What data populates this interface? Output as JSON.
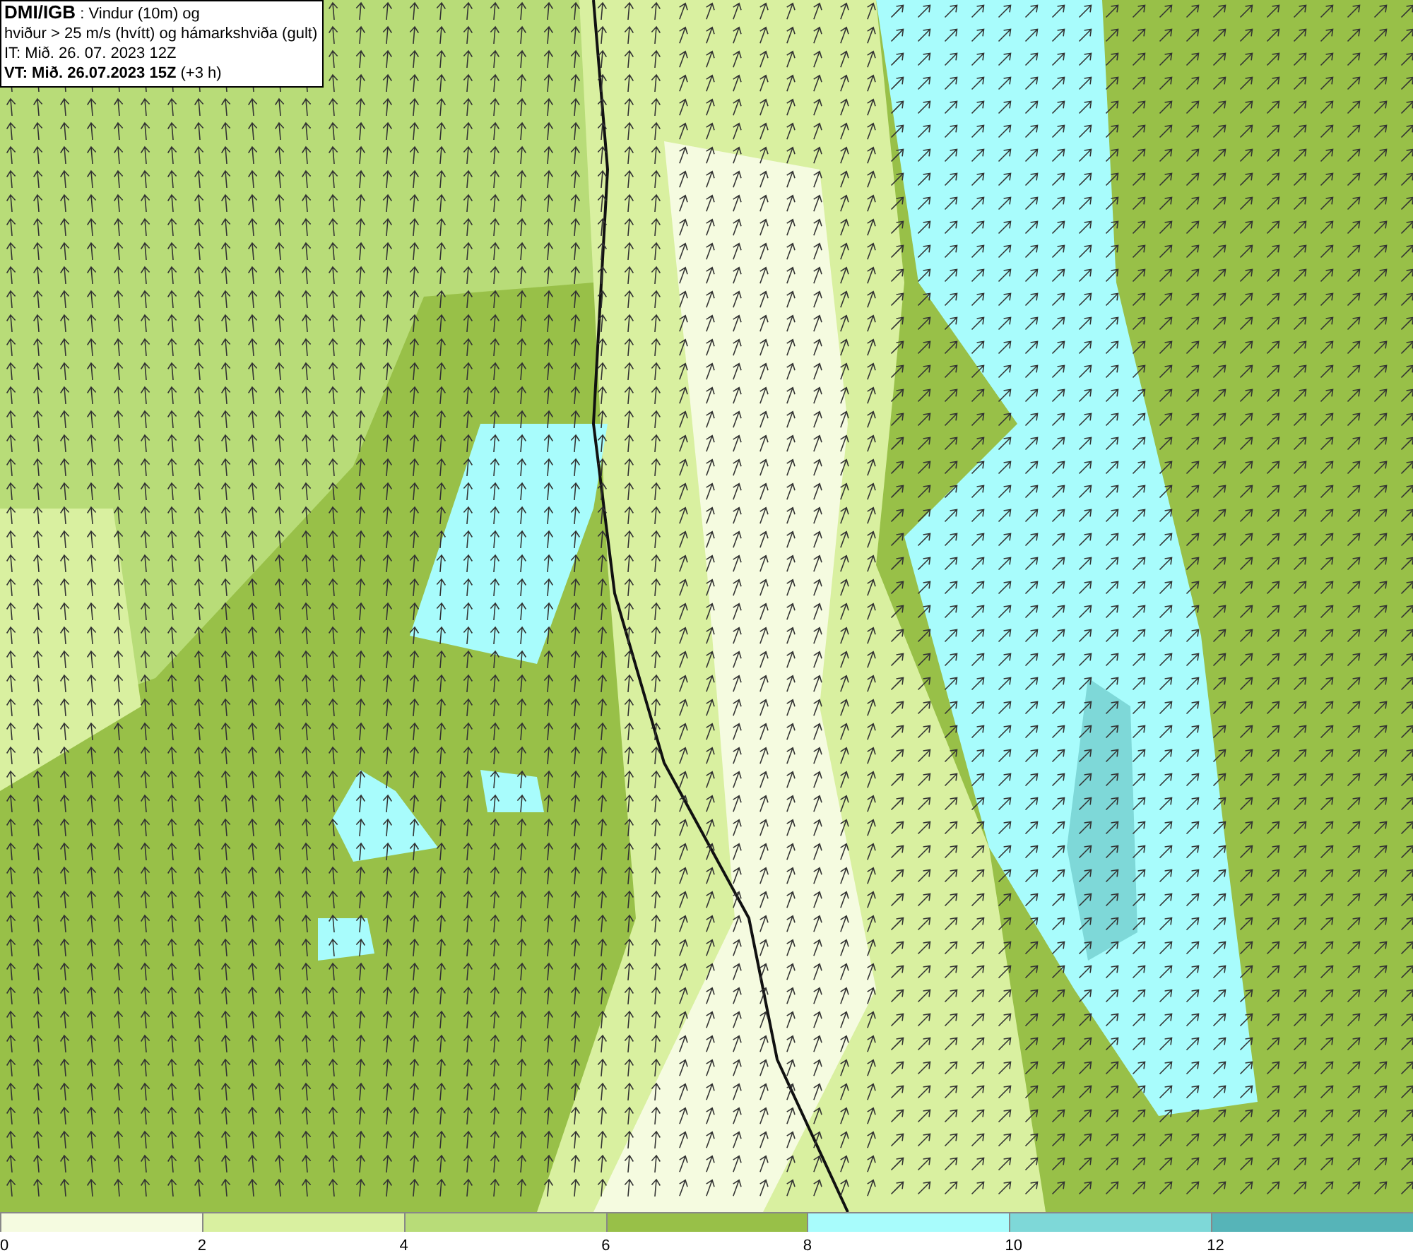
{
  "info_box": {
    "lines": [
      "**DMI/IGB** : Vindur (10m) og",
      "hviður > 25 m/s (hvítt) og hámarkshviða (gult)",
      "IT: Mið. 26. 07. 2023 12Z",
      "**VT: Mið. 26.07.2023 15Z** (+3 h)"
    ]
  },
  "legend": {
    "items": [
      {
        "color": "#f5fbe0",
        "label": "0"
      },
      {
        "color": "#d9f0a0",
        "label": "2"
      },
      {
        "color": "#b8dc78",
        "label": "4"
      },
      {
        "color": "#98c048",
        "label": "6"
      },
      {
        "color": "#a8fcfc",
        "label": "8"
      },
      {
        "color": "#7ed8d8",
        "label": "10"
      },
      {
        "color": "#56b4b8",
        "label": "12"
      }
    ]
  }
}
